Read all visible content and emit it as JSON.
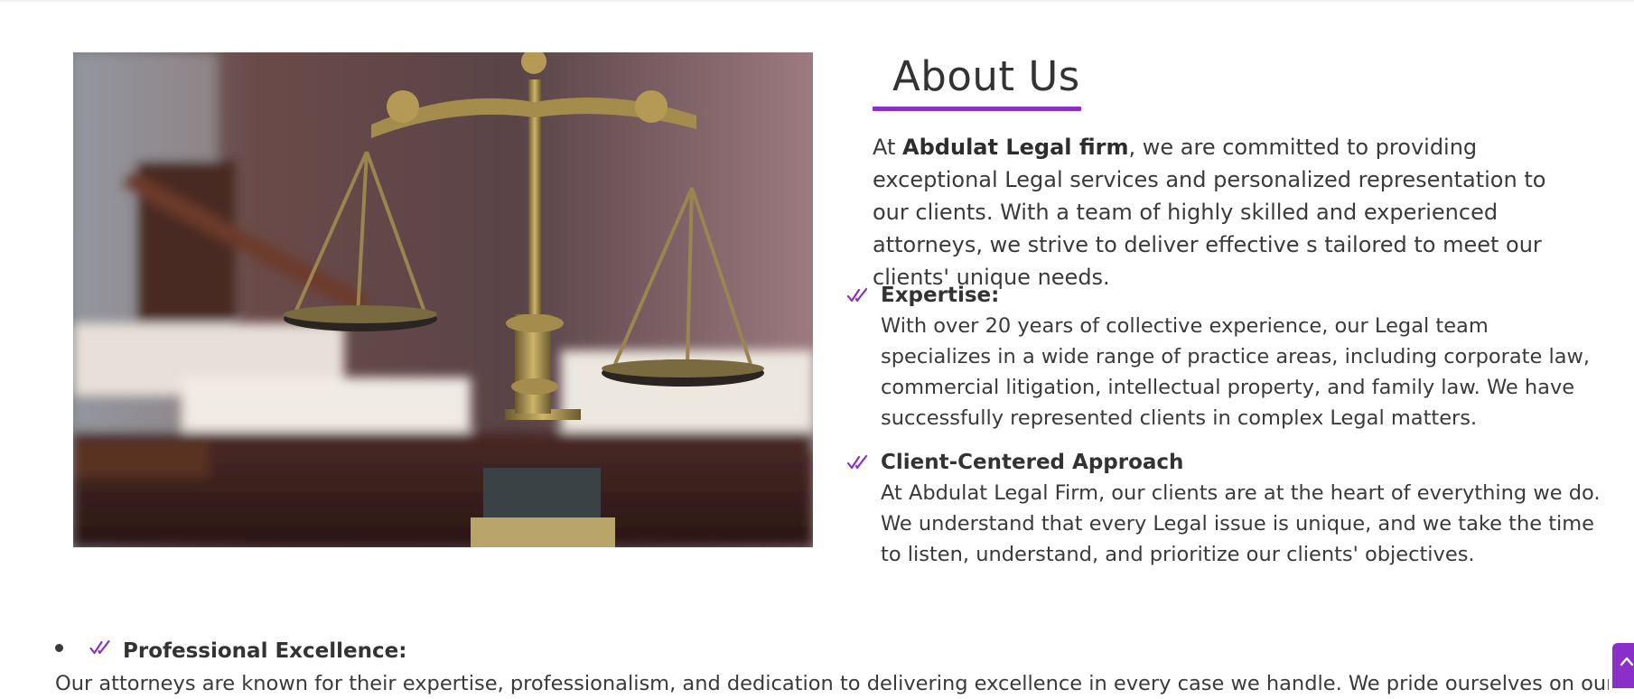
{
  "about": {
    "title": "About Us",
    "intro_prefix": "At ",
    "firm_name": "Abdulat Legal firm",
    "intro_suffix": ", we are committed to providing exceptional Legal services and personalized representation to our clients. With a team of highly skilled and experienced attorneys, we strive to deliver effective s tailored to meet our clients' unique needs."
  },
  "features": [
    {
      "title": "Expertise:",
      "text": "With over 20 years of collective experience, our Legal team specializes in a wide range of practice areas, including corporate law, commercial litigation, intellectual property, and family law. We have successfully represented clients in complex Legal matters."
    },
    {
      "title": "Client-Centered Approach",
      "text": "At Abdulat Legal Firm, our clients are at the heart of everything we do. We understand that every Legal issue is unique, and we take the time to listen, understand, and prioritize our clients' objectives."
    }
  ],
  "bottom_list": {
    "title": "Professional Excellence:",
    "text": "Our attorneys are known for their expertise, professionalism, and dedication to delivering excellence in every case we handle. We pride ourselves on our"
  },
  "icons": {
    "check": "double-check-icon",
    "scroll_top": "chevron-up-icon"
  },
  "colors": {
    "accent": "#8a2fc7",
    "text": "#3a3a3a"
  }
}
